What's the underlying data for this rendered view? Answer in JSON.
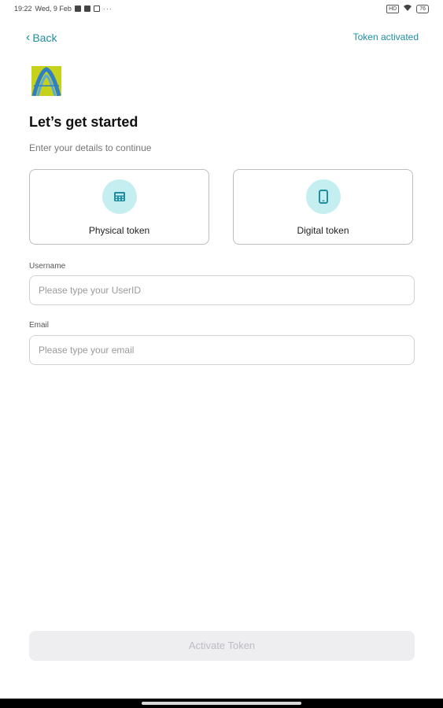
{
  "status_bar": {
    "time": "19:22",
    "date": "Wed, 9 Feb",
    "more": "···",
    "hd_badge": "HD",
    "battery": "76"
  },
  "header": {
    "back_label": "Back",
    "token_activated_label": "Token activated"
  },
  "page": {
    "title": "Let’s get started",
    "subtitle": "Enter your details to continue"
  },
  "token_options": [
    {
      "label": "Physical token",
      "icon": "calculator-icon"
    },
    {
      "label": "Digital token",
      "icon": "phone-icon"
    }
  ],
  "form": {
    "username": {
      "label": "Username",
      "placeholder": "Please type your UserID",
      "value": ""
    },
    "email": {
      "label": "Email",
      "placeholder": "Please type your email",
      "value": ""
    }
  },
  "actions": {
    "activate_label": "Activate Token"
  },
  "colors": {
    "accent": "#1f8fa0",
    "icon_circle": "#c5eef1",
    "logo_bg": "#c5d11b",
    "disabled_button": "#eeeef1"
  }
}
